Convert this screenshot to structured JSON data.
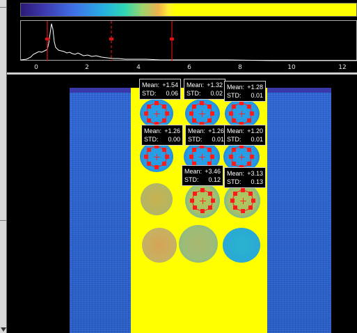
{
  "colorbar": {
    "colors": [
      "#2b1a74",
      "#3e39b0",
      "#3f72e8",
      "#25b3e0",
      "#2fd6b2",
      "#99d56e",
      "#f1b14c",
      "#ffee32",
      "#ffff00"
    ]
  },
  "histogram": {
    "ticks": [
      "0",
      "2",
      "4",
      "6",
      "8",
      "10",
      "12"
    ],
    "markers_values": [
      0,
      2.5,
      4.9
    ],
    "peak_value": 1.25
  },
  "rois": [
    {
      "mean_label": "Mean:",
      "mean": "+1.54",
      "std_label": "STD:",
      "std": "0.06"
    },
    {
      "mean_label": "Mean:",
      "mean": "+1.32",
      "std_label": "STD:",
      "std": "0.02"
    },
    {
      "mean_label": "Mean:",
      "mean": "+1.28",
      "std_label": "STD:",
      "std": "0.01"
    },
    {
      "mean_label": "Mean:",
      "mean": "+1.26",
      "std_label": "STD:",
      "std": "0.00"
    },
    {
      "mean_label": "Mean:",
      "mean": "+1.26",
      "std_label": "STD:",
      "std": "0.01"
    },
    {
      "mean_label": "Mean:",
      "mean": "+1.20",
      "std_label": "STD:",
      "std": "0.01"
    },
    {
      "mean_label": "Mean:",
      "mean": "+3.46",
      "std_label": "STD:",
      "std": "0.12"
    },
    {
      "mean_label": "Mean:",
      "mean": "+3.13",
      "std_label": "STD:",
      "std": "0.13"
    }
  ],
  "colors": {
    "roi_marker": "#ff1a1a",
    "band_yellow": "#ffff00",
    "phantom_blue": "#2f67d6"
  }
}
